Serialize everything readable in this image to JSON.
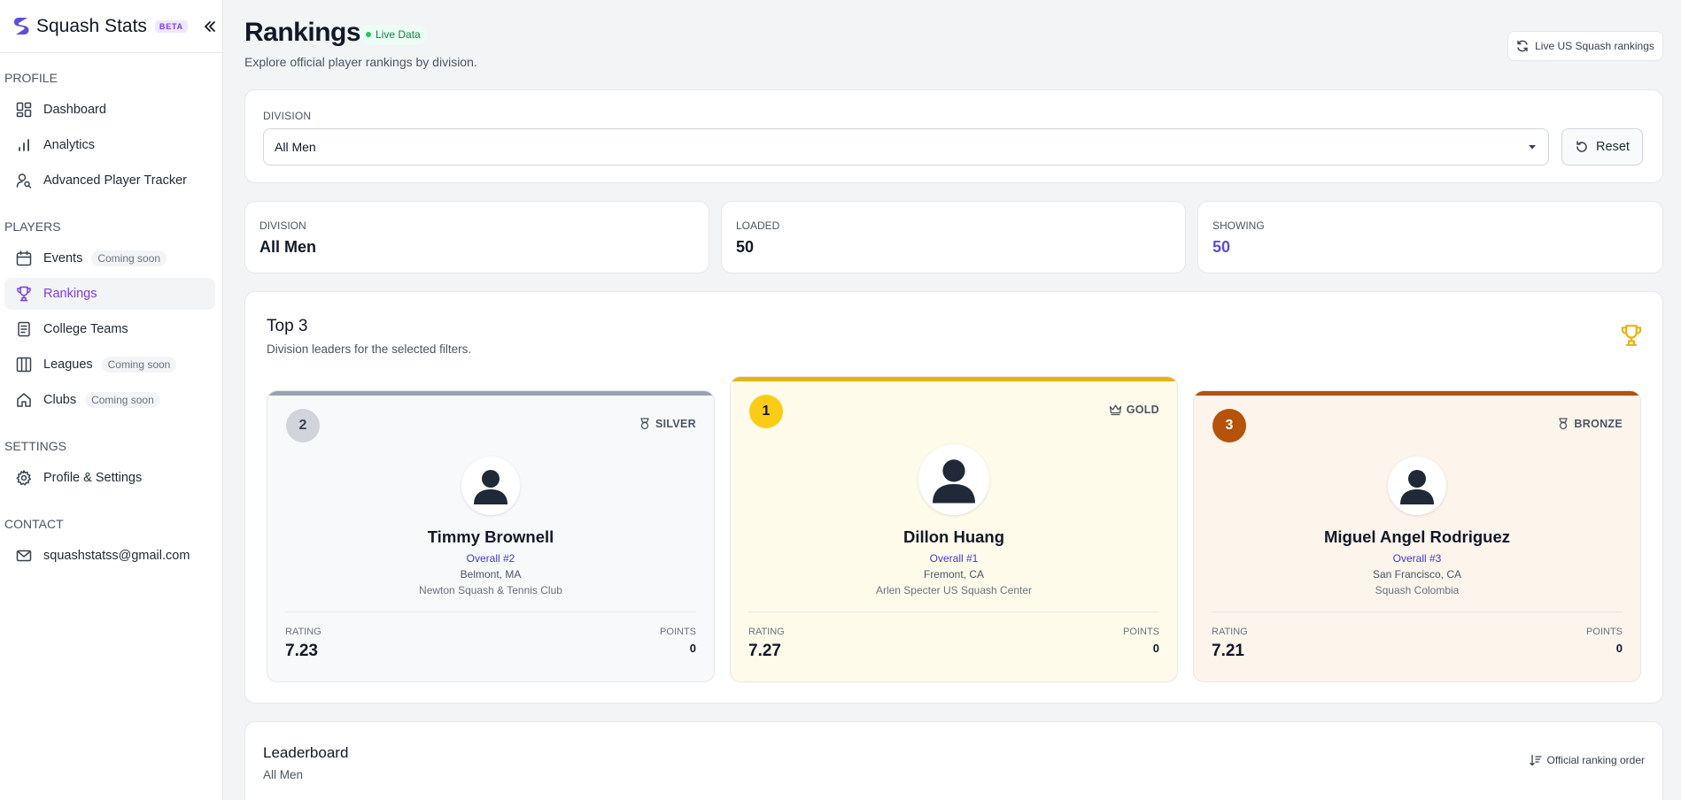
{
  "brand": {
    "name": "Squash Stats",
    "badge": "BETA"
  },
  "sidebar": {
    "sections": {
      "profile": "PROFILE",
      "players": "PLAYERS",
      "settings": "SETTINGS",
      "contact": "CONTACT"
    },
    "items": {
      "dashboard": {
        "label": "Dashboard",
        "icon": "dashboard-icon"
      },
      "analytics": {
        "label": "Analytics",
        "icon": "bar-chart-icon"
      },
      "tracker": {
        "label": "Advanced Player Tracker",
        "icon": "user-search-icon"
      },
      "events": {
        "label": "Events",
        "icon": "calendar-icon",
        "badge": "Coming soon"
      },
      "rankings": {
        "label": "Rankings",
        "icon": "trophy-icon",
        "active": true
      },
      "college": {
        "label": "College Teams",
        "icon": "document-icon"
      },
      "leagues": {
        "label": "Leagues",
        "icon": "columns-icon",
        "badge": "Coming soon"
      },
      "clubs": {
        "label": "Clubs",
        "icon": "home-icon",
        "badge": "Coming soon"
      },
      "settings": {
        "label": "Profile & Settings",
        "icon": "gear-icon"
      },
      "email": {
        "label": "squashstatss@gmail.com",
        "icon": "mail-icon"
      }
    }
  },
  "header": {
    "title": "Rankings",
    "live_badge": "Live Data",
    "subtitle": "Explore official player rankings by division.",
    "live_button": "Live US Squash rankings"
  },
  "filter": {
    "label": "DIVISION",
    "selected": "All Men",
    "reset_label": "Reset"
  },
  "stats": {
    "division": {
      "label": "DIVISION",
      "value": "All Men"
    },
    "loaded": {
      "label": "LOADED",
      "value": "50"
    },
    "showing": {
      "label": "SHOWING",
      "value": "50"
    }
  },
  "top3": {
    "title": "Top 3",
    "subtitle": "Division leaders for the selected filters.",
    "players": {
      "silver": {
        "rank": "2",
        "medal": "SILVER",
        "name": "Timmy Brownell",
        "overall": "Overall #2",
        "location": "Belmont, MA",
        "club": "Newton Squash & Tennis Club",
        "rating_label": "RATING",
        "rating": "7.23",
        "points_label": "POINTS",
        "points": "0"
      },
      "gold": {
        "rank": "1",
        "medal": "GOLD",
        "name": "Dillon Huang",
        "overall": "Overall #1",
        "location": "Fremont, CA",
        "club": "Arlen Specter US Squash Center",
        "rating_label": "RATING",
        "rating": "7.27",
        "points_label": "POINTS",
        "points": "0"
      },
      "bronze": {
        "rank": "3",
        "medal": "BRONZE",
        "name": "Miguel Angel Rodriguez",
        "overall": "Overall #3",
        "location": "San Francisco, CA",
        "club": "Squash Colombia",
        "rating_label": "RATING",
        "rating": "7.21",
        "points_label": "POINTS",
        "points": "0"
      }
    }
  },
  "leaderboard": {
    "title": "Leaderboard",
    "subtitle": "All Men",
    "order_label": "Official ranking order"
  },
  "colors": {
    "accent": "#7c3aed",
    "gold": "#facc15",
    "silver": "#d1d5db",
    "bronze": "#b45309",
    "live_green": "#22c55e"
  }
}
